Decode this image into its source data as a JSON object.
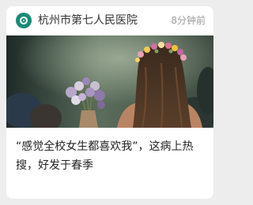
{
  "feed_item": {
    "source_name": "杭州市第七人民医院",
    "source_icon": "hospital-logo-icon",
    "timestamp": "8分钟前",
    "headline": "“感觉全校女生都喜欢我”，这病上热搜，好发于春季",
    "brand_color": "#1f8a78"
  }
}
